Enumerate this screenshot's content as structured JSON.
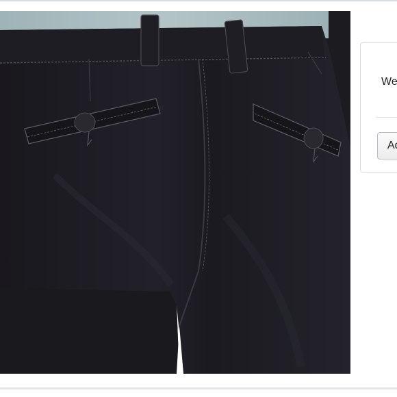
{
  "product_photo": {
    "subject": "dark-trousers-back-view-photo"
  },
  "side_card": {
    "text": "We",
    "button_label": "Ad"
  },
  "colors": {
    "trouser_fabric": "#1c1b20",
    "shirt": "#a9bcc0",
    "stitching": "#56545c",
    "card_border": "#d7dade"
  }
}
